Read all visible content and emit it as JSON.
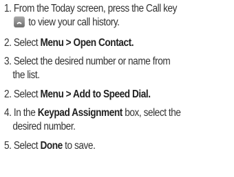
{
  "steps": [
    {
      "number": "1.",
      "line1": "From the Today screen, press the Call key",
      "line2": "to view your call history.",
      "icon": "call-key-icon"
    },
    {
      "number": "2.",
      "pre": "Select ",
      "bold": "Menu > Open Contact.",
      "post": ""
    },
    {
      "number": "3.",
      "line1": "Select the desired number or name from",
      "line2": "the list."
    },
    {
      "number": "2.",
      "pre": "Select ",
      "bold": "Menu > Add to Speed Dial.",
      "post": ""
    },
    {
      "number": "4.",
      "pre": "In the ",
      "bold": "Keypad Assignment",
      "post": " box, select the",
      "line2": "desired number."
    },
    {
      "number": "5.",
      "pre": "Select ",
      "bold": "Done",
      "post": " to save."
    }
  ]
}
